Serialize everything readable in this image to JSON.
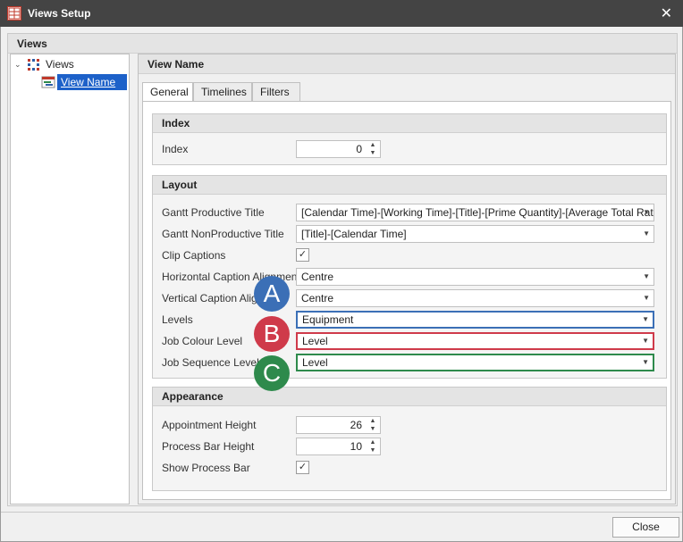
{
  "window": {
    "title": "Views Setup",
    "close_symbol": "✕"
  },
  "views_group": {
    "title": "Views"
  },
  "tree": {
    "root_label": "Views",
    "child_label": "View Name"
  },
  "detail": {
    "title": "View Name",
    "tabs": [
      {
        "label": "General"
      },
      {
        "label": "Timelines"
      },
      {
        "label": "Filters"
      }
    ]
  },
  "index_group": {
    "title": "Index",
    "index_label": "Index",
    "index_value": "0"
  },
  "layout_group": {
    "title": "Layout",
    "gantt_productive_label": "Gantt Productive Title",
    "gantt_productive_value": "[Calendar Time]-[Working Time]-[Title]-[Prime Quantity]-[Average Total Rate]",
    "gantt_nonproductive_label": "Gantt NonProductive Title",
    "gantt_nonproductive_value": "[Title]-[Calendar Time]",
    "clip_captions_label": "Clip Captions",
    "clip_captions_mark": "✓",
    "h_align_label": "Horizontal Caption Alignment",
    "h_align_value": "Centre",
    "v_align_label": "Vertical Caption Alignment",
    "v_align_value": "Centre",
    "levels_label": "Levels",
    "levels_value": "Equipment",
    "job_colour_label": "Job Colour Level",
    "job_colour_value": "Level",
    "job_sequence_label": "Job Sequence Level",
    "job_sequence_value": "Level"
  },
  "appearance_group": {
    "title": "Appearance",
    "appointment_height_label": "Appointment Height",
    "appointment_height_value": "26",
    "process_bar_height_label": "Process Bar Height",
    "process_bar_height_value": "10",
    "show_process_bar_label": "Show Process Bar",
    "show_process_bar_mark": "✓"
  },
  "callouts": {
    "a": {
      "letter": "A",
      "color": "#3b6fb6"
    },
    "b": {
      "letter": "B",
      "color": "#cf3a4a"
    },
    "c": {
      "letter": "C",
      "color": "#2e8a4c"
    }
  },
  "footer": {
    "close_label": "Close"
  }
}
